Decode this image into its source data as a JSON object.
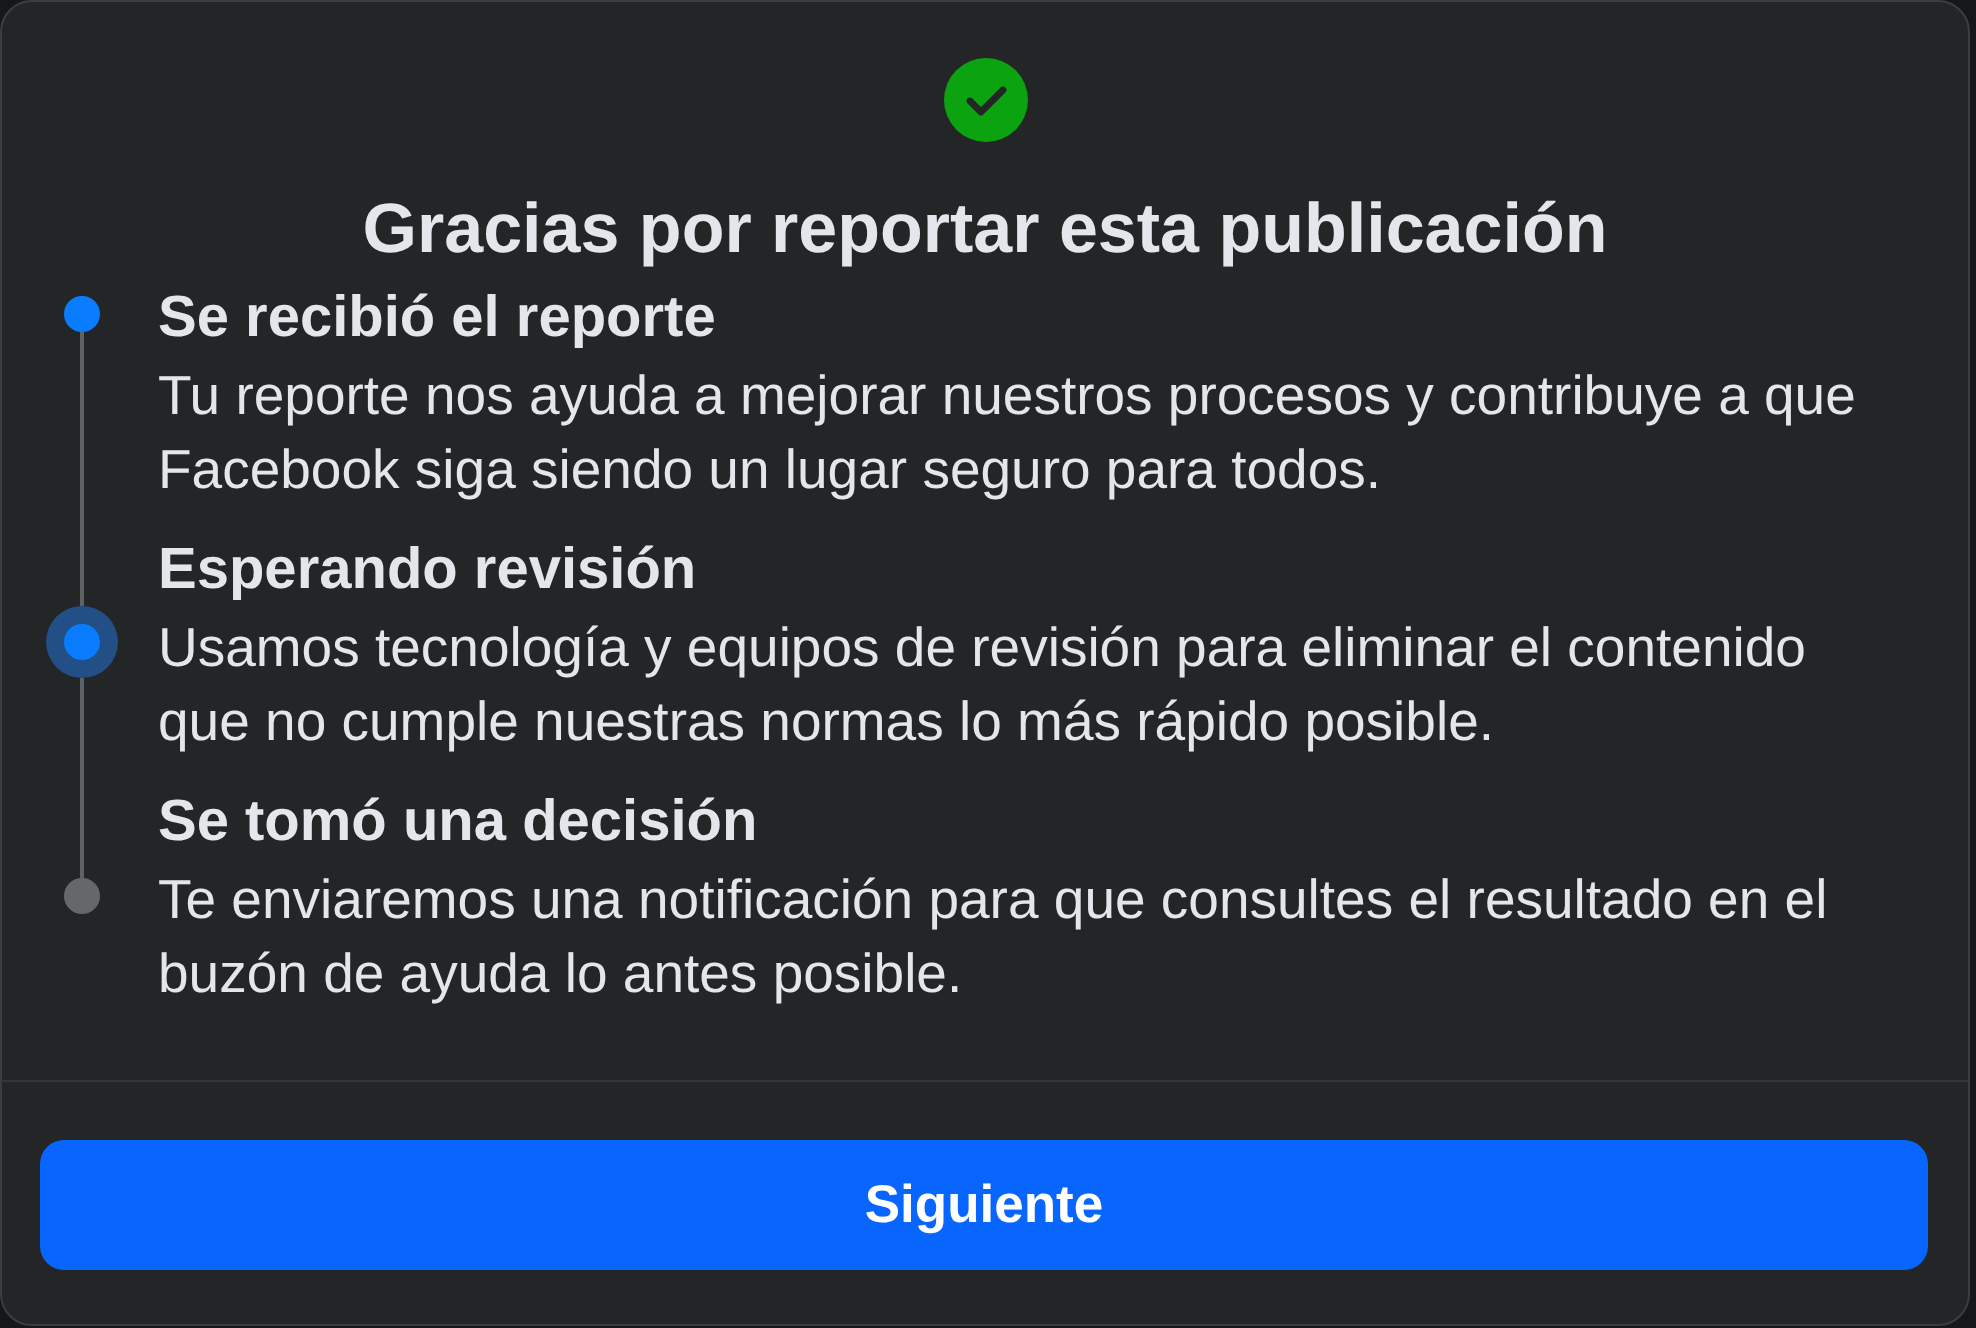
{
  "dialog": {
    "title": "Gracias por reportar esta publicación"
  },
  "steps": [
    {
      "title": "Se recibió el reporte",
      "text": "Tu reporte nos ayuda a mejorar nuestros procesos y contribuye a que Facebook siga siendo un lugar seguro para todos.",
      "reached": true,
      "current": false
    },
    {
      "title": "Esperando revisión",
      "text": "Usamos tecnología y equipos de revisión para eliminar el contenido que no cumple nuestras normas lo más rápido posible.",
      "reached": true,
      "current": true
    },
    {
      "title": "Se tomó una decisión",
      "text": "Te enviaremos una notificación para que consultes el resultado en el buzón de ayuda lo antes posible.",
      "reached": false,
      "current": false
    }
  ],
  "primary_button": {
    "label": "Siguiente"
  }
}
